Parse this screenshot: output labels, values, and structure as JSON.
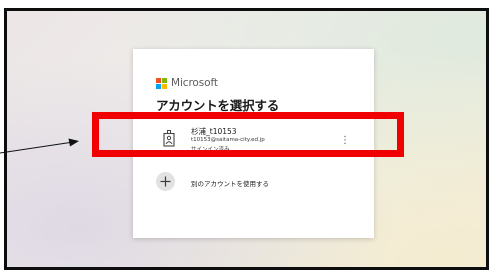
{
  "brand": {
    "name": "Microsoft",
    "logo_colors": [
      "#f25022",
      "#7fba00",
      "#00a4ef",
      "#ffb900"
    ]
  },
  "dialog": {
    "title": "アカウントを選択する"
  },
  "account": {
    "name": "杉浦_t10153",
    "email": "t10153@saitama-city.ed.jp",
    "status": "サインイン済み",
    "icon": "id-badge-icon",
    "menu_icon": "more-options-icon"
  },
  "other_account": {
    "label": "別のアカウントを使用する",
    "icon": "plus-icon"
  },
  "annotation": {
    "highlight_color": "#f00000",
    "arrow_color": "#111111"
  }
}
